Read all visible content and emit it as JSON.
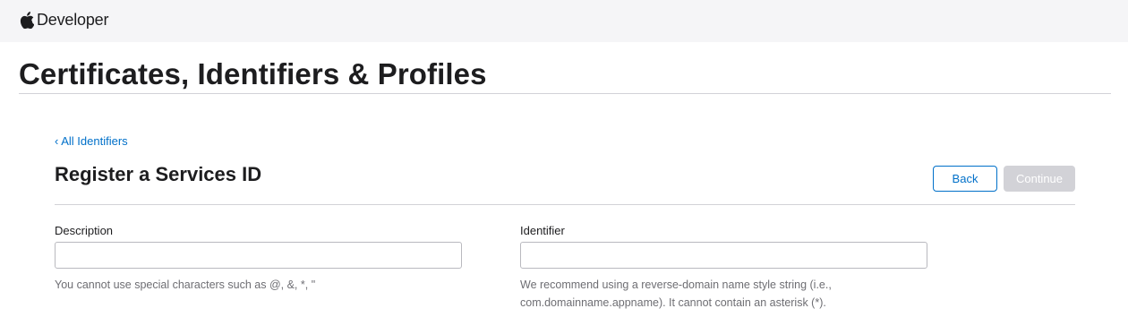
{
  "header": {
    "brand_text": "Developer",
    "logo_icon": "apple-logo-icon"
  },
  "page": {
    "title": "Certificates, Identifiers & Profiles"
  },
  "form": {
    "back_link": "‹ All Identifiers",
    "title": "Register a Services ID",
    "back_button": "Back",
    "continue_button": "Continue",
    "description": {
      "label": "Description",
      "value": "",
      "placeholder": "",
      "help": "You cannot use special characters such as @, &, *, \""
    },
    "identifier": {
      "label": "Identifier",
      "value": "",
      "placeholder": "",
      "help": "We recommend using a reverse-domain name style string (i.e., com.domainname.appname). It cannot contain an asterisk (*)."
    }
  },
  "colors": {
    "link": "#0070c9",
    "topbar_bg": "#f5f5f7",
    "disabled_button": "#d2d2d7"
  }
}
